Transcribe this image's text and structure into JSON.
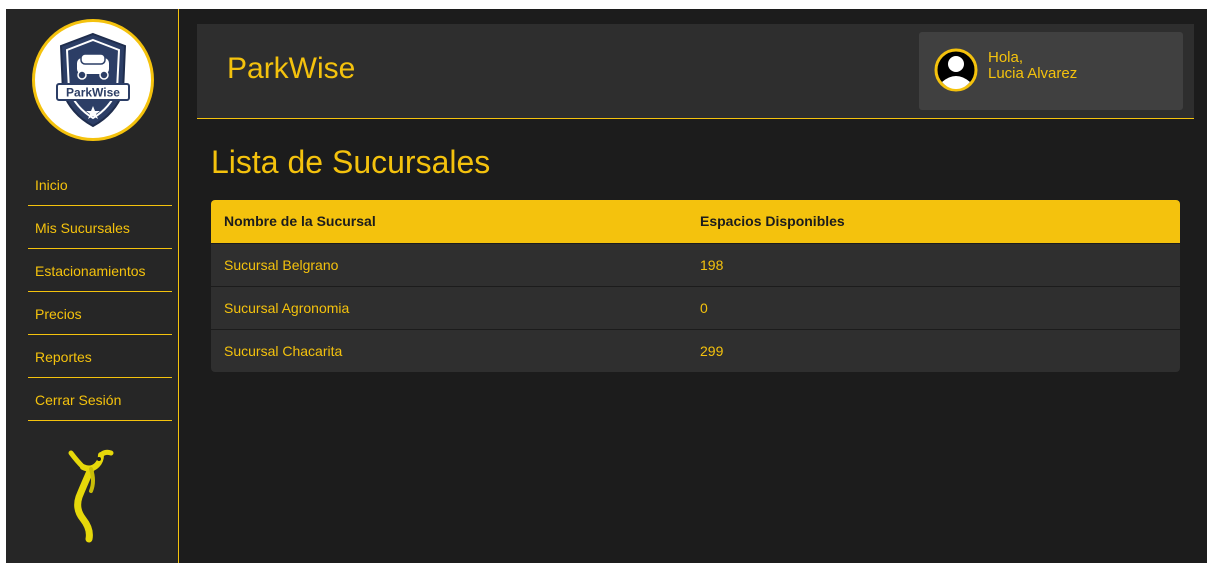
{
  "app": {
    "brand": "ParkWise",
    "accent_color": "#f4c20d",
    "background_color": "#1c1c1c"
  },
  "logo": {
    "text": "ParkWise",
    "icon": "shield-car-logo"
  },
  "sidebar": {
    "items": [
      {
        "label": "Inicio"
      },
      {
        "label": "Mis Sucursales"
      },
      {
        "label": "Estacionamientos"
      },
      {
        "label": "Precios"
      },
      {
        "label": "Reportes"
      },
      {
        "label": "Cerrar Sesión"
      }
    ],
    "mascot_icon": "inflatable-tube-man-icon"
  },
  "header": {
    "greeting": "Hola,",
    "user_name": "Lucia Alvarez",
    "avatar_icon": "user-avatar-icon"
  },
  "main": {
    "title": "Lista de Sucursales",
    "table": {
      "headers": [
        "Nombre de la Sucursal",
        "Espacios Disponibles"
      ],
      "rows": [
        [
          "Sucursal Belgrano",
          "198"
        ],
        [
          "Sucursal Agronomia",
          "0"
        ],
        [
          "Sucursal Chacarita",
          "299"
        ]
      ]
    }
  }
}
